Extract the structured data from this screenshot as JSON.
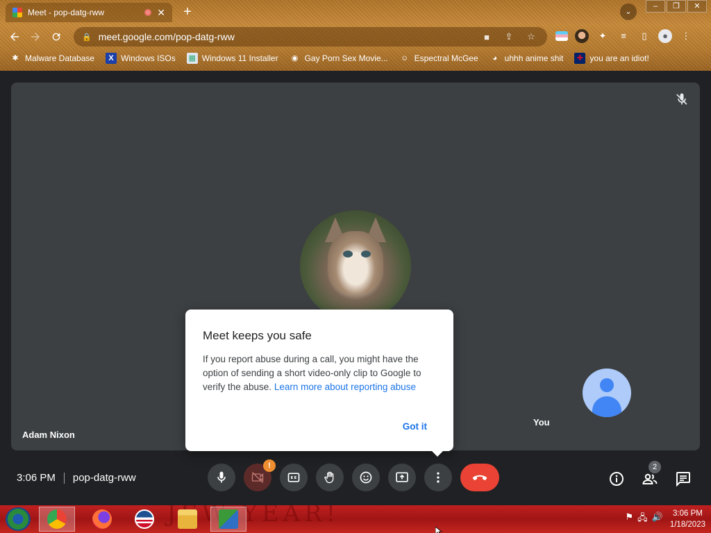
{
  "browser": {
    "tab_title": "Meet - pop-datg-rww",
    "tab_close": "✕",
    "new_tab": "+",
    "url": "meet.google.com/pop-datg-rww",
    "window_buttons": [
      "–",
      "❐",
      "✕"
    ],
    "tab_search_icon": "⌄"
  },
  "bookmarks": [
    {
      "label": "Malware Database",
      "icon": "✱"
    },
    {
      "label": "Windows ISOs",
      "icon": "X"
    },
    {
      "label": "Windows 11 Installer",
      "icon": "▦"
    },
    {
      "label": "Gay Porn Sex Movie...",
      "icon": "◉"
    },
    {
      "label": "Espectral McGee",
      "icon": "☺"
    },
    {
      "label": "uhhh anime shit",
      "icon": "◕"
    },
    {
      "label": "you are an idiot!",
      "icon": "✚"
    }
  ],
  "meeting": {
    "main_participant_name": "Adam Nixon",
    "self_label": "You",
    "time": "3:06 PM",
    "room_code": "pop-datg-rww",
    "participant_count": "2",
    "camera_warning": "!"
  },
  "dialog": {
    "title": "Meet keeps you safe",
    "body": "If you report abuse during a call, you might have the option of sending a short video-only clip to Google to verify the abuse. ",
    "link": "Learn more about reporting abuse",
    "button": "Got it"
  },
  "taskbar": {
    "wallpaper_text": "JEW YEAR!",
    "time": "3:06 PM",
    "date": "1/18/2023",
    "tray_icons": [
      "⚑",
      "🖧",
      "🔊"
    ]
  },
  "colors": {
    "meet_bg": "#202124",
    "tile_bg": "#3c4043",
    "end_call": "#ea4335",
    "link_blue": "#1a73e8",
    "taskbar_red": "#b01a18"
  }
}
